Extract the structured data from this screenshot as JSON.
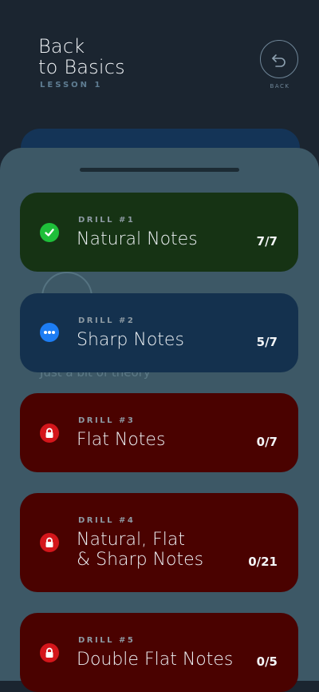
{
  "header": {
    "title_line1": "Back",
    "title_line2": "to Basics",
    "lesson": "LESSON 1",
    "back_label": "BACK"
  },
  "background_text": "Just a bit of theory",
  "drills": [
    {
      "number": "DRILL #1",
      "name": "Natural Notes",
      "count": "7/7",
      "status": "completed",
      "icon": "check-circle-icon"
    },
    {
      "number": "DRILL #2",
      "name": "Sharp Notes",
      "count": "5/7",
      "status": "in-progress",
      "icon": "ellipsis-circle-icon"
    },
    {
      "number": "DRILL #3",
      "name": "Flat Notes",
      "count": "0/7",
      "status": "locked",
      "icon": "lock-icon"
    },
    {
      "number": "DRILL #4",
      "name_line1": "Natural, Flat",
      "name_line2": "& Sharp Notes",
      "count": "0/21",
      "status": "locked",
      "icon": "lock-icon"
    },
    {
      "number": "DRILL #5",
      "name": "Double Flat Notes",
      "count": "0/5",
      "status": "locked",
      "icon": "lock-icon"
    }
  ],
  "colors": {
    "completed": "#163314",
    "in_progress": "#14314e",
    "locked": "#4a0200",
    "sheet": "#3d5866"
  }
}
